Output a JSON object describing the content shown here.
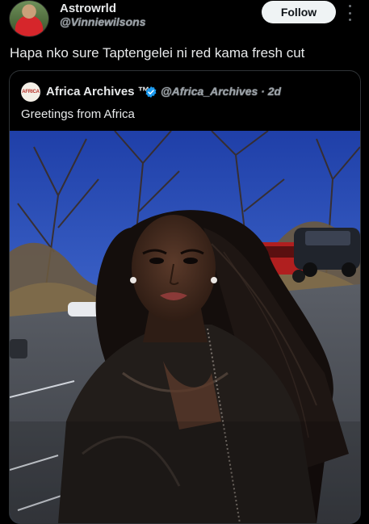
{
  "post": {
    "display_name": "Astrowrld",
    "handle": "@Vinniewilsons",
    "follow_label": "Follow",
    "text": "Hapa nko sure Taptengelei ni red kama fresh cut"
  },
  "quote": {
    "display_name": "Africa Archives ™",
    "handle": "@Africa_Archives",
    "time": "· 2d",
    "text": "Greetings from Africa",
    "avatar_text": "AFRICA",
    "verified_color": "#1d9bf0"
  },
  "icons": {
    "more": "more-vertical-icon",
    "verified": "verified-badge-icon"
  }
}
